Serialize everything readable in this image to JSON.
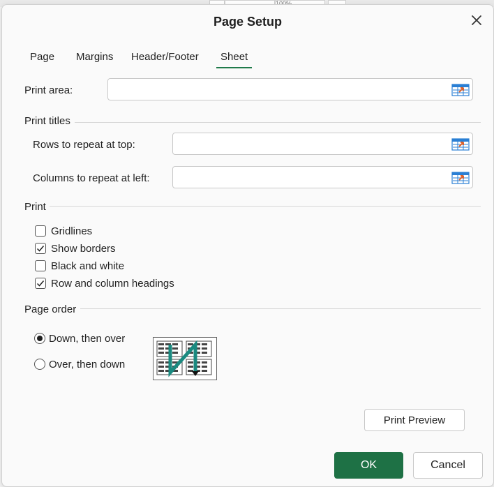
{
  "background": {
    "zoom_text": "100%"
  },
  "dialog": {
    "title": "Page Setup",
    "close_icon": "close-icon"
  },
  "tabs": [
    {
      "label": "Page",
      "active": false
    },
    {
      "label": "Margins",
      "active": false
    },
    {
      "label": "Header/Footer",
      "active": false
    },
    {
      "label": "Sheet",
      "active": true
    }
  ],
  "print_area": {
    "label": "Print area:",
    "value": ""
  },
  "print_titles": {
    "heading": "Print titles",
    "rows_label": "Rows to repeat at top:",
    "rows_value": "",
    "cols_label": "Columns to repeat at left:",
    "cols_value": ""
  },
  "print": {
    "heading": "Print",
    "options": [
      {
        "label": "Gridlines",
        "checked": false
      },
      {
        "label": "Show borders",
        "checked": true
      },
      {
        "label": "Black and white",
        "checked": false
      },
      {
        "label": "Row and column headings",
        "checked": true
      }
    ]
  },
  "page_order": {
    "heading": "Page order",
    "options": [
      {
        "label": "Down, then over",
        "selected": true
      },
      {
        "label": "Over, then down",
        "selected": false
      }
    ]
  },
  "buttons": {
    "print_preview": "Print Preview",
    "ok": "OK",
    "cancel": "Cancel"
  },
  "colors": {
    "accent": "#1e7145",
    "tab_underline": "#1f7a4a",
    "order_arrow": "#1a8a80"
  }
}
